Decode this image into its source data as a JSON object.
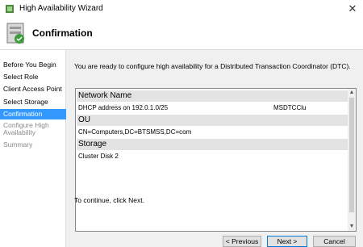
{
  "window": {
    "title": "High Availability Wizard"
  },
  "header": {
    "title": "Confirmation"
  },
  "nav": {
    "items": [
      {
        "label": "Before You Begin",
        "state": "done"
      },
      {
        "label": "Select Role",
        "state": "done"
      },
      {
        "label": "Client Access Point",
        "state": "done"
      },
      {
        "label": "Select Storage",
        "state": "done"
      },
      {
        "label": "Confirmation",
        "state": "active"
      },
      {
        "label": "Configure High Availability",
        "state": "disabled"
      },
      {
        "label": "Summary",
        "state": "disabled"
      }
    ]
  },
  "content": {
    "intro": "You are ready to configure high availability for a Distributed Transaction Coordinator (DTC).",
    "sections": [
      {
        "header": "Network Name",
        "rows": [
          {
            "text": "DHCP address on 192.0.1.0/25",
            "value": "MSDTCClu"
          }
        ]
      },
      {
        "header": "OU",
        "rows": [
          {
            "text": "CN=Computers,DC=BTSMSS,DC=com"
          }
        ]
      },
      {
        "header": "Storage",
        "rows": [
          {
            "text": "Cluster Disk 2"
          }
        ]
      }
    ],
    "footnote": "To continue, click Next."
  },
  "buttons": {
    "previous": "< Previous",
    "next": "Next >",
    "cancel": "Cancel"
  },
  "colors": {
    "accent": "#3399ff",
    "section_bg": "#e3e3e3",
    "disabled_text": "#8a8a8a"
  }
}
